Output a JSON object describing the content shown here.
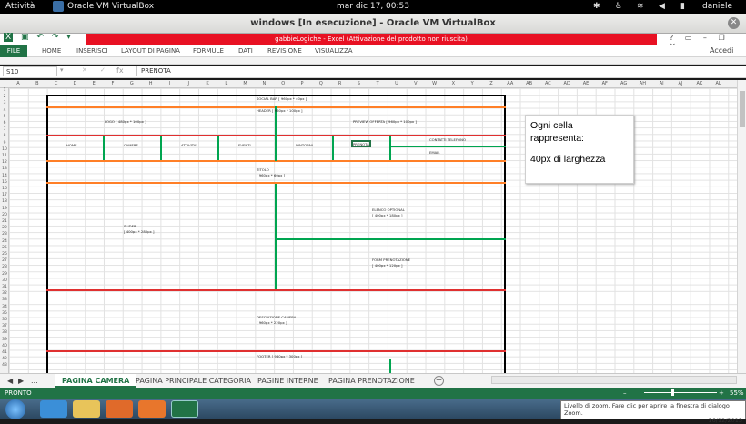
{
  "topbar": {
    "activities": "Attività",
    "app_name": "Oracle VM VirtualBox",
    "clock": "mar dic 17, 00:53",
    "user": "daniele"
  },
  "vbox_window": {
    "title": "windows [In esecuzione] - Oracle VM VirtualBox"
  },
  "excel": {
    "title_warning": "gabbieLogiche - Excel (Attivazione del prodotto non riuscita)",
    "ribbon_tabs": [
      "FILE",
      "HOME",
      "INSERISCI",
      "LAYOUT DI PAGINA",
      "FORMULE",
      "DATI",
      "REVISIONE",
      "VISUALIZZA"
    ],
    "accedi": "Accedi",
    "namebox": "S10",
    "fx": "fx",
    "formula_value": "PRENOTA",
    "columns": [
      "A",
      "B",
      "C",
      "D",
      "E",
      "F",
      "G",
      "H",
      "I",
      "J",
      "K",
      "L",
      "M",
      "N",
      "O",
      "P",
      "Q",
      "R",
      "S",
      "T",
      "U",
      "V",
      "W",
      "X",
      "Y",
      "Z",
      "AA",
      "AB",
      "AC",
      "AD",
      "AE",
      "AF",
      "AG",
      "AH",
      "AI",
      "AJ",
      "AK",
      "AL"
    ],
    "rows": [
      "1",
      "2",
      "3",
      "4",
      "5",
      "6",
      "7",
      "8",
      "9",
      "10",
      "11",
      "12",
      "13",
      "14",
      "15",
      "16",
      "17",
      "18",
      "19",
      "20",
      "21",
      "22",
      "23",
      "24",
      "25",
      "26",
      "27",
      "28",
      "29",
      "30",
      "31",
      "32",
      "33",
      "34",
      "35",
      "36",
      "37",
      "38",
      "39",
      "40",
      "41",
      "42",
      "43"
    ]
  },
  "mockup": {
    "social_bar": "SOCIAL BAR [ 960px * 40px ]",
    "header": "HEADER [ 960px * 100px ]",
    "logo": "LOGO [ 480px * 100px ]",
    "preview": "PREVIEW OFFERTA [ 960px * 100px ]",
    "nav": [
      "HOME",
      "CAMERE",
      "ATTIVITA'",
      "EVENTI",
      "DINTORNI",
      "PRENOTA"
    ],
    "contatti": "CONTATTI TELEFONO",
    "email": "EMAIL",
    "titolo": "TITOLO",
    "titolo_size": "[ 960px * 60px ]",
    "slider": "SLIDER",
    "slider_size": "[ 400px * 280px ]",
    "elenco": "ELENCO OPTIONAL",
    "elenco_size": "[ 400px * 180px ]",
    "form": "FORM PRENOTAZIONE",
    "form_size": "[ 400px * 120px ]",
    "descrizione": "DESCRIZIONE CAMERA",
    "descrizione_size": "[ 960px * 220px ]",
    "footer": "FOOTER [ 960px * 300px ]"
  },
  "callout": {
    "line1": "Ogni cella",
    "line2": "rappresenta:",
    "line3": "40px di larghezza"
  },
  "sheet_tabs": [
    "PAGINA CAMERA",
    "PAGINA PRINCIPALE CATEGORIA",
    "PAGINE INTERNE",
    "PAGINA PRENOTAZIONE"
  ],
  "sheet_nav_ellipsis": "...",
  "status": {
    "ready": "PRONTO",
    "zoom_percent": "55%"
  },
  "tooltip": "Livello di zoom. Fare clic per aprire la finestra di dialogo Zoom.",
  "taskbar_date": "16/12/2013",
  "colors": {
    "excel_green": "#217346",
    "warn_red": "#e81123",
    "line_red": "#e03030",
    "line_orange": "#ff7f27",
    "line_green": "#00a550"
  }
}
